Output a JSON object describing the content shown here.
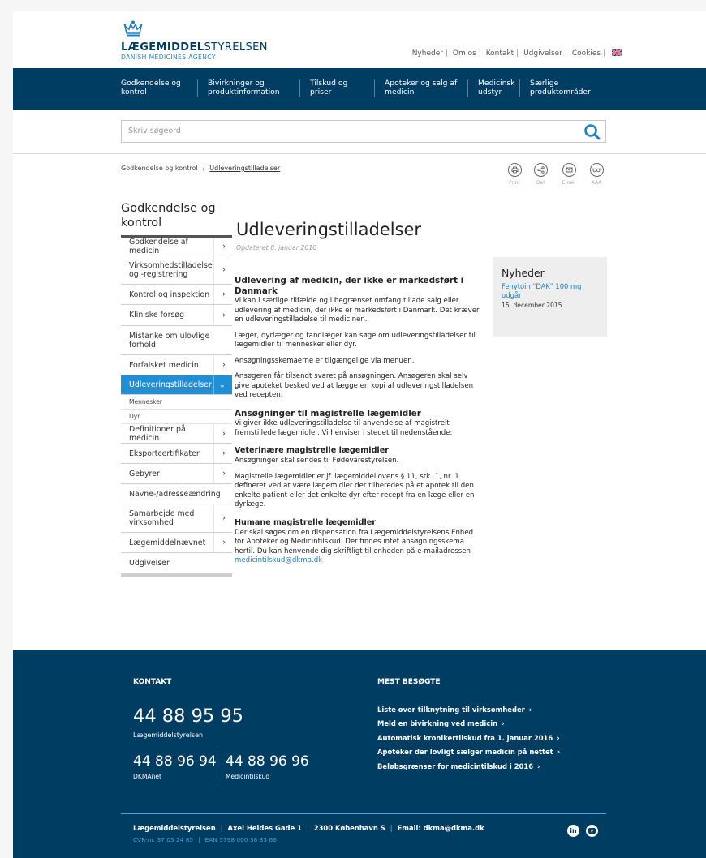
{
  "logo": {
    "name_bold": "LÆGEMIDDEL",
    "name_rest": "STYRELSEN",
    "subtitle": "DANISH MEDICINES AGENCY"
  },
  "utility_nav": [
    "Nyheder",
    "Om os",
    "Kontakt",
    "Udgivelser",
    "Cookies"
  ],
  "main_nav": [
    "Godkendelse og kontrol",
    "Bivirkninger og produktinformation",
    "Tilskud og priser",
    "Apoteker og salg af medicin",
    "Medicinsk udstyr",
    "Særlige produktområder"
  ],
  "search": {
    "placeholder": "Skriv søgeord"
  },
  "breadcrumb": {
    "parent": "Godkendelse og kontrol",
    "separator": "/",
    "current": "Udleveringstilladelser"
  },
  "tools": {
    "print": "Print",
    "share": "Del",
    "email": "Email",
    "text_size": "AAA"
  },
  "sidebar": {
    "title": "Godkendelse og kontrol",
    "items": [
      {
        "label": "Godkendelse af medicin"
      },
      {
        "label": "Virksomhedstilladelse og -registrering"
      },
      {
        "label": "Kontrol og inspektion"
      },
      {
        "label": "Kliniske forsøg"
      },
      {
        "label": "Mistanke om ulovlige forhold"
      },
      {
        "label": "Forfalsket medicin"
      },
      {
        "label": "Udleveringstilladelser"
      },
      {
        "label": "Mennesker"
      },
      {
        "label": "Dyr"
      },
      {
        "label": "Definitioner på medicin"
      },
      {
        "label": "Eksportcertifikater"
      },
      {
        "label": "Gebyrer"
      },
      {
        "label": "Navne-/adresseændring"
      },
      {
        "label": "Samarbejde med virksomhed"
      },
      {
        "label": "Lægemiddelnævnet"
      },
      {
        "label": "Udgivelser"
      }
    ]
  },
  "article": {
    "title": "Udleveringstilladelser",
    "updated": "Opdateret 8. januar 2016",
    "h1": "Udlevering af medicin, der ikke er markedsført i Danmark",
    "p1": "Vi kan i særlige tilfælde og i begrænset omfang tillade salg eller udlevering af medicin, der ikke er markedsført i Danmark. Det kræver en udleveringstilladelse til medicinen.",
    "p2": "Læger, dyrlæger og tandlæger kan søge om udleveringstilladelser til lægemidler til mennesker eller dyr.",
    "p3": "Ansøgningsskemaerne er tilgængelige via menuen.",
    "p4": "Ansøgeren får tilsendt svaret på ansøgningen. Ansøgeren skal selv give apoteket besked ved at lægge en kopi af udleveringstilladelsen ved recepten.",
    "h2": "Ansøgninger til magistrelle lægemidler",
    "p5": "Vi giver ikke udleveringstilladelse til anvendelse af magistrelt fremstillede lægemidler. Vi henviser i stedet til nedenstående:",
    "h3a": "Veterinære magistrelle lægemidler",
    "p6": "Ansøgninger skal sendes til Fødevarestyrelsen.",
    "p7": "Magistrelle lægemidler er jf. lægemiddellovens § 11, stk. 1, nr. 1 defineret ved at være lægemidler der tilberedes på et apotek til den enkelte patient eller det enkelte dyr efter recept fra en læge eller en dyrlæge.",
    "h3b": "Humane magistrelle lægemidler",
    "p8": "Der skal søges om en dispensation fra Lægemiddelstyrelsens Enhed for Apoteker og Medicintilskud. Der findes intet ansøgningsskema hertil. Du kan henvende dig skriftligt til enheden på e-mailadressen",
    "email": "medicintilskud@dkma.dk"
  },
  "news": {
    "heading": "Nyheder",
    "link": "Fenytoin \"DAK\" 100 mg udgår",
    "date": "15. december 2015"
  },
  "footer": {
    "contact_heading": "KONTAKT",
    "main_phone": "44 88 95 95",
    "main_phone_label": "Lægemiddelstyrelsen",
    "phone2": "44 88 96 94",
    "phone2_label": "DKMAnet",
    "phone3": "44 88 96 96",
    "phone3_label": "Medicintilskud",
    "popular_heading": "MEST BESØGTE",
    "popular_links": [
      "Liste over tilknytning til virksomheder",
      "Meld en bivirkning ved medicin",
      "Automatisk kronikertilskud fra 1. januar 2016",
      "Apoteker der lovligt sælger medicin på nettet",
      "Beløbsgrænser for medicintilskud i 2016"
    ],
    "address": [
      "Lægemiddelstyrelsen",
      "Axel Heides Gade 1",
      "2300 København S",
      "Email: dkma@dkma.dk"
    ],
    "ids": [
      "CVR-nr. 37 05 24 85",
      "EAN 5798 000 36 33 66"
    ],
    "social": {
      "linkedin": "in"
    }
  },
  "colors": {
    "navy": "#003d62",
    "accent_blue": "#1f8fd8",
    "link_blue": "#1f7dc3"
  }
}
